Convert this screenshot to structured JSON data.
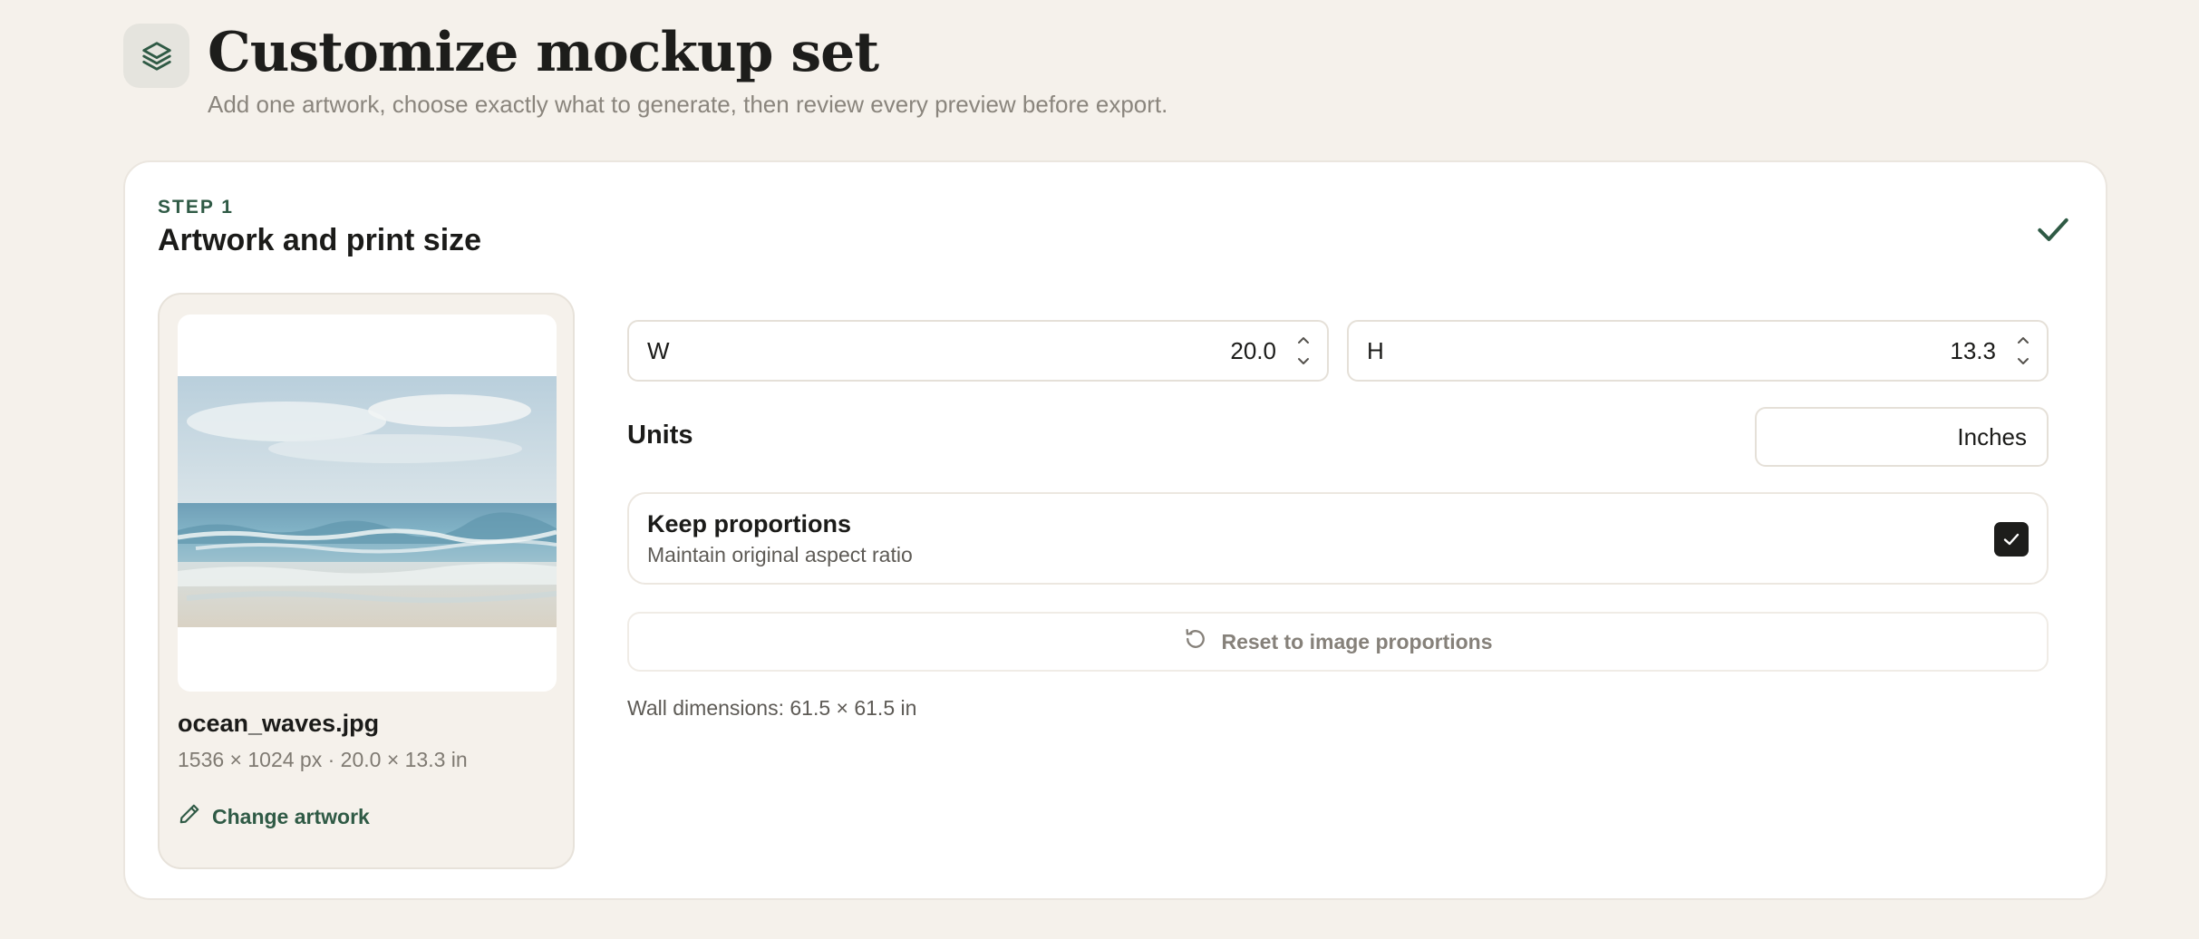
{
  "header": {
    "icon": "layers-icon",
    "title": "Customize mockup set",
    "subtitle": "Add one artwork, choose exactly what to generate, then review every preview before export."
  },
  "step": {
    "label": "STEP 1",
    "title": "Artwork and print size",
    "status_icon": "check-icon",
    "completed": true
  },
  "artwork": {
    "file_name": "ocean_waves.jpg",
    "meta": "1536 × 1024 px · 20.0 × 13.3 in",
    "change_label": "Change artwork",
    "change_icon": "pencil-icon"
  },
  "size": {
    "width_label": "W",
    "width_value": "20.0",
    "height_label": "H",
    "height_value": "13.3"
  },
  "units": {
    "label": "Units",
    "selected": "Inches"
  },
  "keep_proportions": {
    "title": "Keep proportions",
    "subtitle": "Maintain original aspect ratio",
    "checked": true
  },
  "reset": {
    "label": "Reset to image proportions",
    "icon": "reset-icon"
  },
  "wall_dimensions": "Wall dimensions: 61.5 × 61.5 in",
  "colors": {
    "background": "#f5f1eb",
    "accent_green": "#2f5a45",
    "text_dark": "#1b1b19",
    "text_muted": "#8a857d"
  }
}
